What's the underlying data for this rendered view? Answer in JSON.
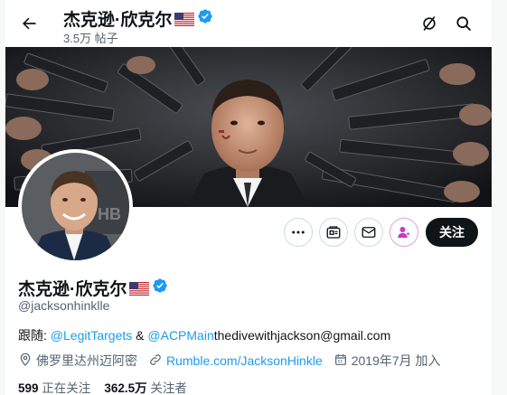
{
  "header": {
    "name": "杰克逊·欣克尔",
    "posts_count": "3.5万 帖子"
  },
  "profile": {
    "name": "杰克逊·欣克尔",
    "handle": "@jacksonhinklle",
    "bio_prefix": "跟随: ",
    "bio_link1": "@LegitTargets",
    "bio_and": " & ",
    "bio_link2": "@ACPMain",
    "bio_email": "thedivewithjackson@gmail.com",
    "location": "佛罗里达州迈阿密",
    "website": "Rumble.com/JacksonHinkle",
    "joined": "2019年7月 加入",
    "following_count": "599",
    "following_label": " 正在关注",
    "followers_count": "362.5万",
    "followers_label": " 关注者"
  },
  "actions": {
    "follow_label": "关注"
  },
  "colors": {
    "accent": "#1d9bf0",
    "verified": "#1d9bf0",
    "subscribe_icon": "#c936cc",
    "follow_bg": "#0f1419"
  },
  "icons": [
    "back-arrow-icon",
    "grok-icon",
    "search-icon",
    "more-icon",
    "subscribe-newsletter-icon",
    "message-icon",
    "subscribe-icon",
    "location-icon",
    "link-icon",
    "calendar-icon",
    "verified-icon",
    "us-flag-icon"
  ]
}
